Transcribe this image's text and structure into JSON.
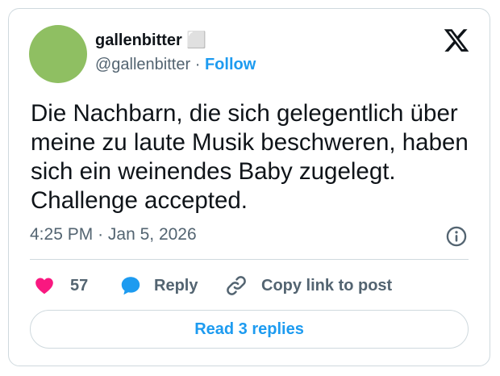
{
  "author": {
    "display_name": "gallenbitter ⬜",
    "handle": "@gallenbitter",
    "separator": "·",
    "follow_label": "Follow"
  },
  "tweet": {
    "text": "Die Nachbarn, die sich gelegentlich über meine zu laute Musik beschweren, haben sich ein weinendes Baby zugelegt. Challenge accepted.",
    "time": "4:25 PM",
    "date_separator": "·",
    "date": "Jan 5, 2026"
  },
  "actions": {
    "like_count": "57",
    "reply_label": "Reply",
    "copy_label": "Copy link to post"
  },
  "replies_button": {
    "label": "Read 3 replies"
  },
  "colors": {
    "accent": "#1d9bf0",
    "like": "#f91880",
    "avatar": "#8fbf62",
    "muted": "#536471"
  },
  "icons": [
    "x-logo-icon",
    "info-icon",
    "heart-icon",
    "reply-bubble-icon",
    "link-icon"
  ]
}
